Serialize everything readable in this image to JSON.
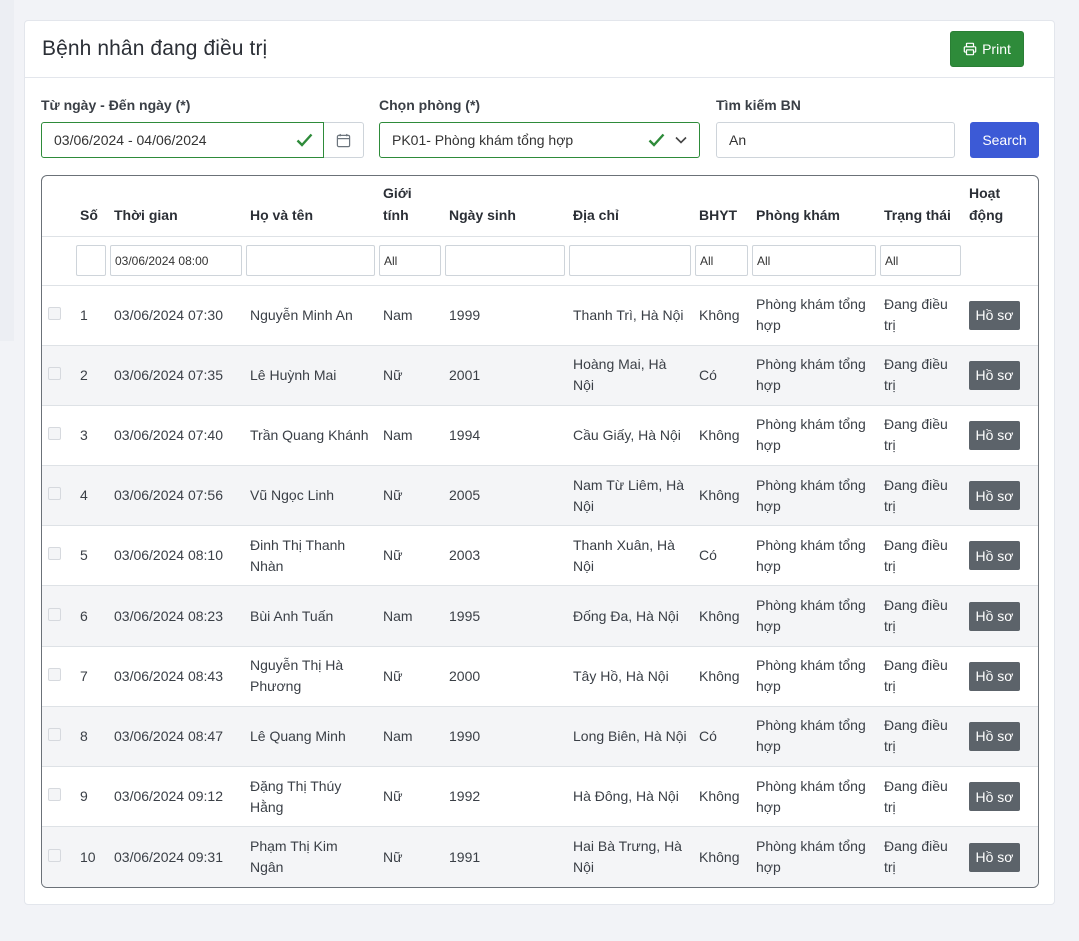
{
  "header": {
    "title": "Bệnh nhân đang điều trị",
    "print_label": "Print"
  },
  "filters": {
    "date_label": "Từ ngày - Đến ngày (*)",
    "date_value": "03/06/2024 - 04/06/2024",
    "room_label": "Chọn phòng (*)",
    "room_value": "PK01- Phòng khám tổng hợp",
    "search_label": "Tìm kiếm BN",
    "search_value": "An",
    "search_button": "Search"
  },
  "table": {
    "columns": [
      "Số",
      "Thời gian",
      "Họ và tên",
      "Giới tính",
      "Ngày sinh",
      "Địa chỉ",
      "BHYT",
      "Phòng khám",
      "Trạng thái",
      "Hoạt động"
    ],
    "column_filters": {
      "time": "03/06/2024 08:00",
      "gender": "All",
      "bhyt": "All",
      "clinic": "All",
      "status": "All"
    },
    "action_label": "Hồ sơ",
    "rows": [
      {
        "no": "1",
        "time": "03/06/2024 07:30",
        "name": "Nguyễn Minh An",
        "gender": "Nam",
        "dob": "1999",
        "address": "Thanh Trì, Hà Nội",
        "bhyt": "Không",
        "clinic": "Phòng khám tổng hợp",
        "status": "Đang điều trị"
      },
      {
        "no": "2",
        "time": "03/06/2024 07:35",
        "name": "Lê Huỳnh Mai",
        "gender": "Nữ",
        "dob": "2001",
        "address": "Hoàng Mai, Hà Nội",
        "bhyt": "Có",
        "clinic": "Phòng khám tổng hợp",
        "status": "Đang điều trị"
      },
      {
        "no": "3",
        "time": "03/06/2024 07:40",
        "name": "Trần Quang Khánh",
        "gender": "Nam",
        "dob": "1994",
        "address": "Cầu Giấy, Hà Nội",
        "bhyt": "Không",
        "clinic": "Phòng khám tổng hợp",
        "status": "Đang điều trị"
      },
      {
        "no": "4",
        "time": "03/06/2024 07:56",
        "name": "Vũ Ngọc Linh",
        "gender": "Nữ",
        "dob": "2005",
        "address": "Nam Từ Liêm, Hà Nội",
        "bhyt": "Không",
        "clinic": "Phòng khám tổng hợp",
        "status": "Đang điều trị"
      },
      {
        "no": "5",
        "time": "03/06/2024 08:10",
        "name": "Đinh Thị Thanh Nhàn",
        "gender": "Nữ",
        "dob": "2003",
        "address": "Thanh Xuân, Hà Nội",
        "bhyt": "Có",
        "clinic": "Phòng khám tổng hợp",
        "status": "Đang điều trị"
      },
      {
        "no": "6",
        "time": "03/06/2024 08:23",
        "name": "Bùi Anh Tuấn",
        "gender": "Nam",
        "dob": "1995",
        "address": "Đống Đa, Hà Nội",
        "bhyt": "Không",
        "clinic": "Phòng khám tổng hợp",
        "status": "Đang điều trị"
      },
      {
        "no": "7",
        "time": "03/06/2024 08:43",
        "name": "Nguyễn Thị Hà Phương",
        "gender": "Nữ",
        "dob": "2000",
        "address": "Tây Hồ, Hà Nội",
        "bhyt": "Không",
        "clinic": "Phòng khám tổng hợp",
        "status": "Đang điều trị"
      },
      {
        "no": "8",
        "time": "03/06/2024 08:47",
        "name": "Lê Quang Minh",
        "gender": "Nam",
        "dob": "1990",
        "address": "Long Biên, Hà Nội",
        "bhyt": "Có",
        "clinic": "Phòng khám tổng hợp",
        "status": "Đang điều trị"
      },
      {
        "no": "9",
        "time": "03/06/2024 09:12",
        "name": "Đặng Thị Thúy Hằng",
        "gender": "Nữ",
        "dob": "1992",
        "address": "Hà Đông, Hà Nội",
        "bhyt": "Không",
        "clinic": "Phòng khám tổng hợp",
        "status": "Đang điều trị"
      },
      {
        "no": "10",
        "time": "03/06/2024 09:31",
        "name": "Phạm Thị Kim Ngân",
        "gender": "Nữ",
        "dob": "1991",
        "address": "Hai Bà Trưng, Hà Nội",
        "bhyt": "Không",
        "clinic": "Phòng khám tổng hợp",
        "status": "Đang điều trị"
      }
    ]
  },
  "icons": {
    "print": "printer-icon",
    "calendar": "calendar-icon",
    "valid": "check-icon",
    "dropdown": "chevron-down-icon"
  },
  "colors": {
    "print_button": "#2e8b3a",
    "search_button": "#3c5ad6",
    "action_button": "#5c636a",
    "valid_border": "#2e8b3a"
  }
}
